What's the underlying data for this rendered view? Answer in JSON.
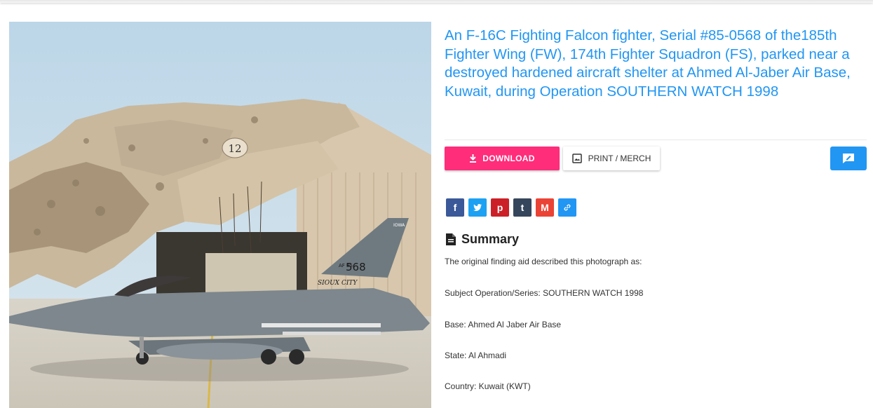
{
  "title": "An F-16C Fighting Falcon fighter, Serial #85-0568 of the185th Fighter Wing (FW), 174th Fighter Squadron (FS), parked near a destroyed hardened aircraft shelter at Ahmed Al-Jaber Air Base, Kuwait, during Operation SOUTHERN WATCH 1998",
  "photo": {
    "hangar_number": "12",
    "tail_flag": "IOWA",
    "tail_af_label": "AF 85",
    "tail_serial": "568",
    "nose_name": "SIOUX CITY"
  },
  "actions": {
    "download_label": "DOWNLOAD",
    "print_label": "PRINT / MERCH"
  },
  "share_icons": [
    "facebook-icon",
    "twitter-icon",
    "pinterest-icon",
    "tumblr-icon",
    "gmail-icon",
    "link-icon"
  ],
  "colors": {
    "title": "#2196f3",
    "download": "#ff2d7a",
    "feedback": "#2196f3",
    "facebook": "#3b5998",
    "twitter": "#1da1f2",
    "pinterest": "#cb2027",
    "tumblr": "#35465c",
    "gmail": "#ea4335",
    "link": "#2196f3"
  },
  "summary": {
    "heading": "Summary",
    "intro": "The original finding aid described this photograph as:",
    "lines": [
      "Subject Operation/Series: SOUTHERN WATCH 1998",
      "Base: Ahmed Al Jaber Air Base",
      "State: Al Ahmadi",
      "Country: Kuwait (KWT)"
    ]
  }
}
